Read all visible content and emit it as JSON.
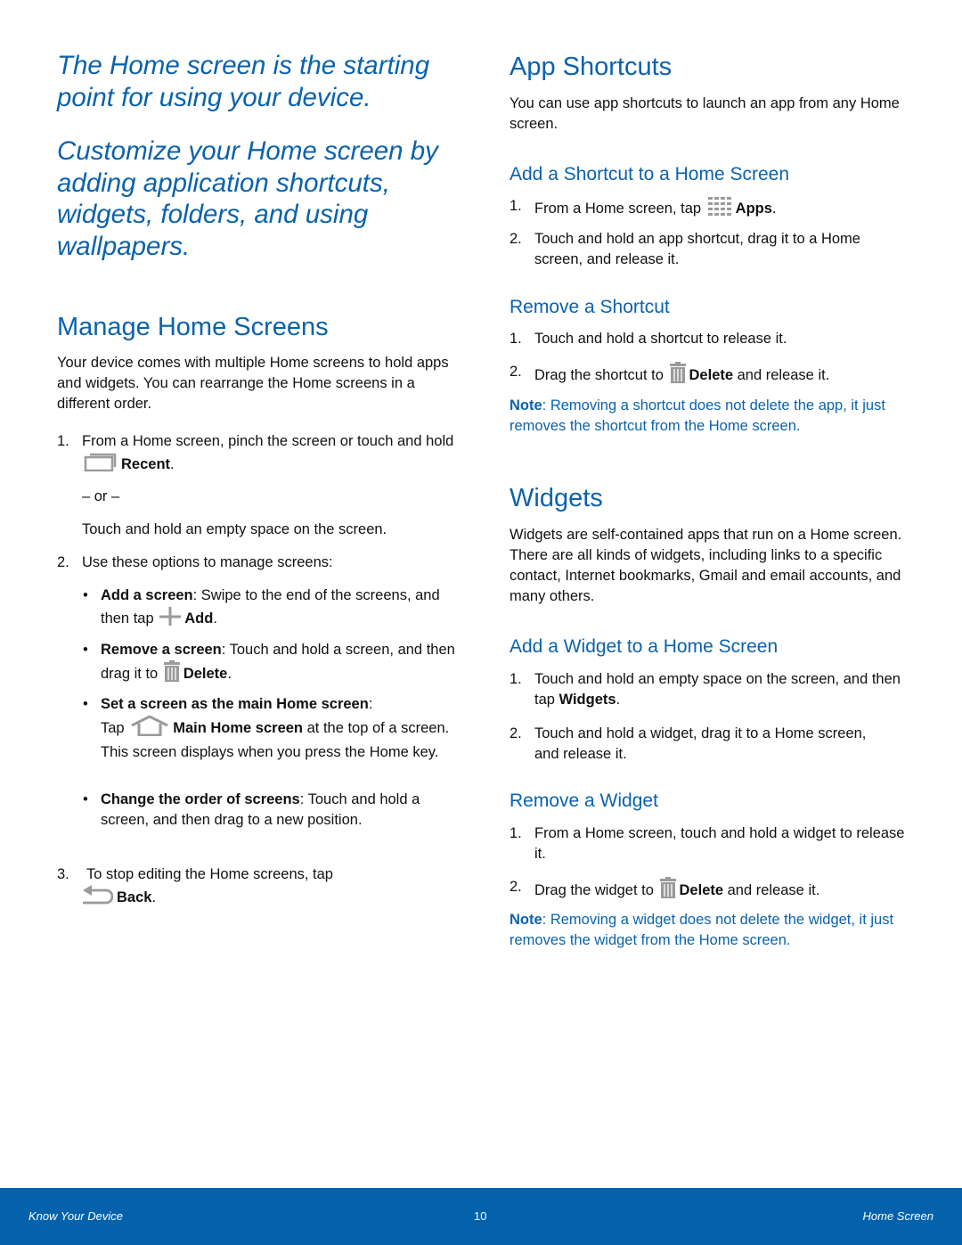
{
  "intro": {
    "line1": "The Home screen is the starting point for using your device.",
    "line2": "Customize your Home screen by adding application shortcuts, widgets, folders, and using wallpapers."
  },
  "manage": {
    "title": "Manage Home Screens",
    "desc": "Your device comes with multiple Home screens to hold apps and widgets. You can rearrange the Home screens in a different order.",
    "step1": {
      "num": "1.",
      "text_a": "From a Home screen, pinch the screen or touch and hold",
      "icon": "recent-apps-icon",
      "bold": "Recent",
      "end": ".",
      "or": "– or –",
      "alt": "Touch and hold an empty space on the screen."
    },
    "step2": {
      "num": "2.",
      "text": "Use these options to manage screens:",
      "bullets": [
        {
          "bold": "Add a screen",
          "text": ": Swipe to the end of the screens, and then tap",
          "icon": "plus-icon",
          "bold2": "Add",
          "end": "."
        },
        {
          "bold": "Remove a screen",
          "text": ": Touch and hold a screen, and then drag it to",
          "icon": "trash-icon",
          "bold2": "Delete",
          "end": "."
        },
        {
          "bold": "Set a screen as the main Home screen",
          "text": ":",
          "text2": "Tap",
          "icon": "home-icon",
          "bold2": "Main Home screen",
          "end": " at the top of a screen. This screen displays when you press the Home key."
        },
        {
          "bold": "Change the order of screens",
          "text": ": Touch and hold a screen, and then drag to a new position."
        }
      ]
    },
    "step3": {
      "num": "3.",
      "text": "To stop editing the Home screens, tap",
      "icon": "back-icon",
      "bold": "Back",
      "end": "."
    }
  },
  "shortcuts": {
    "title": "App Shortcuts",
    "desc": "You can use app shortcuts to launch an app from any Home screen.",
    "add": {
      "title": "Add a Shortcut to a Home Screen",
      "steps": [
        {
          "num": "1.",
          "text": "From a Home screen, tap",
          "icon": "apps-grid-icon",
          "bold": "Apps",
          "end": "."
        },
        {
          "num": "2.",
          "text": "Touch and hold an app shortcut, drag it to a Home screen, and release it."
        }
      ]
    },
    "remove": {
      "title": "Remove a Shortcut",
      "steps": [
        {
          "num": "1.",
          "text": "Touch and hold a shortcut to release it."
        },
        {
          "num": "2.",
          "text": "Drag the shortcut to",
          "icon": "trash-icon",
          "bold": "Delete",
          "end": " and release it."
        }
      ],
      "note_label": "Note",
      "note_text": ": Removing a shortcut does not delete the app, it just removes the shortcut from the Home screen."
    }
  },
  "widgets": {
    "title": "Widgets",
    "desc": "Widgets are self-contained apps that run on a Home screen. There are all kinds of widgets, including links to a specific contact, Internet bookmarks, Gmail and email accounts, and many others.",
    "add": {
      "title": "Add a Widget to a Home Screen",
      "steps": [
        {
          "num": "1.",
          "text": "Touch and hold an empty space on the screen, and then tap",
          "bold": "Widgets",
          "end": "."
        },
        {
          "num": "2.",
          "text": "Touch and hold a widget, drag it to a Home screen, and release it."
        }
      ]
    },
    "remove": {
      "title": "Remove a Widget",
      "steps": [
        {
          "num": "1.",
          "text": "From a Home screen, touch and hold a widget to release it."
        },
        {
          "num": "2.",
          "text": "Drag the widget to",
          "icon": "trash-icon",
          "bold": "Delete",
          "end": " and release it."
        }
      ],
      "note_label": "Note",
      "note_text": ": Removing a widget does not delete the widget, it just removes the widget from the Home screen."
    }
  },
  "footer": {
    "left": "Know Your Device",
    "page": "10",
    "right": "Home Screen"
  },
  "colors": {
    "accent": "#0a62ad",
    "footer_bg": "#0461ac",
    "icon_gray": "#9a9a9a"
  }
}
